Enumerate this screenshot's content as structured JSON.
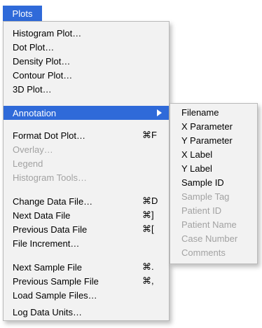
{
  "menubar": {
    "title": "Plots"
  },
  "menu": {
    "items": [
      {
        "label": "Histogram Plot…",
        "shortcut": "",
        "disabled": false
      },
      {
        "label": "Dot Plot…",
        "shortcut": "",
        "disabled": false
      },
      {
        "label": "Density Plot…",
        "shortcut": "",
        "disabled": false
      },
      {
        "label": "Contour Plot…",
        "shortcut": "",
        "disabled": false
      },
      {
        "label": "3D Plot…",
        "shortcut": "",
        "disabled": false
      },
      {
        "label": "Annotation",
        "shortcut": "",
        "disabled": false,
        "highlighted": true
      },
      {
        "label": "Format Dot Plot…",
        "shortcut": "⌘F",
        "disabled": false
      },
      {
        "label": "Overlay…",
        "shortcut": "",
        "disabled": true
      },
      {
        "label": "Legend",
        "shortcut": "",
        "disabled": true
      },
      {
        "label": "Histogram Tools…",
        "shortcut": "",
        "disabled": true
      },
      {
        "label": "Change Data File…",
        "shortcut": "⌘D",
        "disabled": false
      },
      {
        "label": "Next Data File",
        "shortcut": "⌘]",
        "disabled": false
      },
      {
        "label": "Previous Data File",
        "shortcut": "⌘[",
        "disabled": false
      },
      {
        "label": "File Increment…",
        "shortcut": "",
        "disabled": false
      },
      {
        "label": "Next Sample File",
        "shortcut": "⌘.",
        "disabled": false
      },
      {
        "label": "Previous Sample File",
        "shortcut": "⌘,",
        "disabled": false
      },
      {
        "label": "Load Sample Files…",
        "shortcut": "",
        "disabled": false
      },
      {
        "label": "Log Data Units…",
        "shortcut": "",
        "disabled": false
      }
    ]
  },
  "submenu": {
    "items": [
      {
        "label": "Filename",
        "disabled": false
      },
      {
        "label": "X Parameter",
        "disabled": false
      },
      {
        "label": "Y Parameter",
        "disabled": false
      },
      {
        "label": "X Label",
        "disabled": false
      },
      {
        "label": "Y Label",
        "disabled": false
      },
      {
        "label": "Sample ID",
        "disabled": false
      },
      {
        "label": "Sample Tag",
        "disabled": true
      },
      {
        "label": "Patient ID",
        "disabled": true
      },
      {
        "label": "Patient Name",
        "disabled": true
      },
      {
        "label": "Case Number",
        "disabled": true
      },
      {
        "label": "Comments",
        "disabled": true
      }
    ]
  },
  "colors": {
    "highlight": "#2f6ad9",
    "menu_bg": "#f2f2f2",
    "disabled_text": "#a2a2a2"
  }
}
